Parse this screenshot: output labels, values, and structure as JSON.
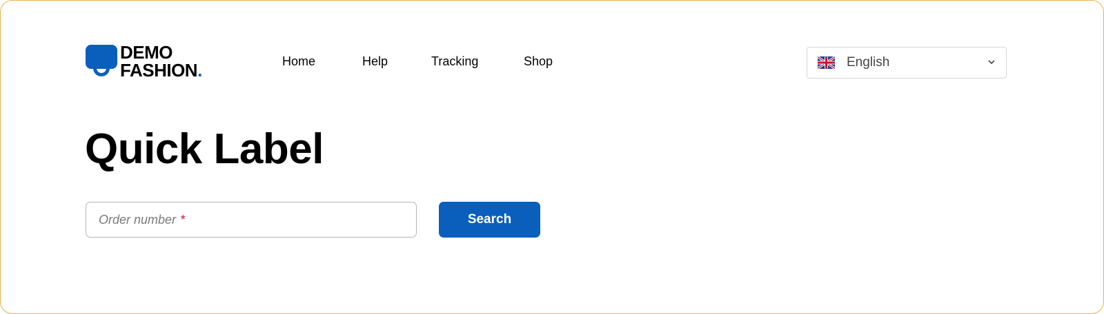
{
  "brand": {
    "line1": "DEMO",
    "line2": "FASHION",
    "dot": ".",
    "accent_color": "#0a5fbd"
  },
  "nav": {
    "items": [
      {
        "label": "Home"
      },
      {
        "label": "Help"
      },
      {
        "label": "Tracking"
      },
      {
        "label": "Shop"
      }
    ]
  },
  "language": {
    "selected": "English",
    "flag_icon": "uk-flag-icon",
    "dropdown_icon": "chevron-down-icon"
  },
  "page": {
    "title": "Quick Label"
  },
  "form": {
    "order_placeholder": "Order number",
    "required_marker": "*",
    "search_label": "Search"
  },
  "colors": {
    "primary": "#0a5fbd",
    "required": "#c0182f",
    "frame_border": "#e7b04e"
  }
}
